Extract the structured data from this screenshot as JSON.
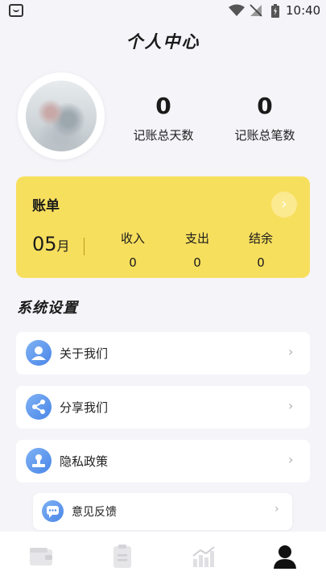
{
  "status_bar": {
    "time": "10:40"
  },
  "header": {
    "title": "个人中心"
  },
  "stats": [
    {
      "value": "0",
      "label": "记账总天数"
    },
    {
      "value": "0",
      "label": "记账总笔数"
    }
  ],
  "bill": {
    "title": "账单",
    "arrow": "›",
    "month": "05",
    "month_unit": "月",
    "columns": [
      {
        "label": "收入",
        "value": "0"
      },
      {
        "label": "支出",
        "value": "0"
      },
      {
        "label": "结余",
        "value": "0"
      }
    ]
  },
  "settings": {
    "title": "系统设置",
    "items": [
      {
        "label": "关于我们",
        "icon": "about-us-icon"
      },
      {
        "label": "分享我们",
        "icon": "share-icon"
      },
      {
        "label": "隐私政策",
        "icon": "privacy-icon"
      },
      {
        "label": "意见反馈",
        "icon": "feedback-icon"
      }
    ],
    "chevron": "›"
  },
  "tabbar": {
    "tabs": [
      {
        "icon": "wallet-icon",
        "active": false
      },
      {
        "icon": "ledger-icon",
        "active": false
      },
      {
        "icon": "chart-icon",
        "active": false
      },
      {
        "icon": "profile-icon",
        "active": true
      }
    ]
  },
  "colors": {
    "accent": "#f7df5e",
    "icon_blue": "#4a86e8",
    "background": "#f5f4f9"
  }
}
